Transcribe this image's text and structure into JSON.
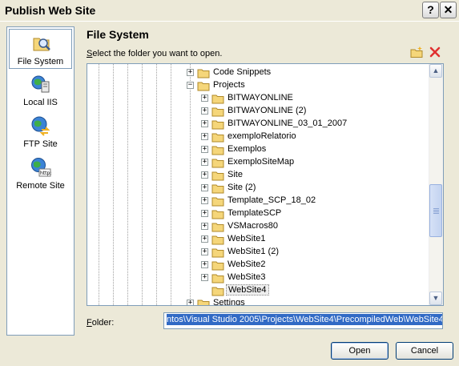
{
  "window": {
    "title": "Publish Web Site",
    "help_glyph": "?",
    "close_glyph": "✕"
  },
  "sidebar": {
    "items": [
      {
        "label": "File System",
        "icon": "folder-search-icon",
        "selected": true
      },
      {
        "label": "Local IIS",
        "icon": "globe-computer-icon",
        "selected": false
      },
      {
        "label": "FTP Site",
        "icon": "globe-arrows-icon",
        "selected": false
      },
      {
        "label": "Remote Site",
        "icon": "globe-http-icon",
        "selected": false
      }
    ]
  },
  "main": {
    "heading": "File System",
    "prompt_accel": "S",
    "prompt_rest": "elect the folder you want to open."
  },
  "tree": {
    "items": [
      {
        "label": "Code Snippets",
        "level": 0,
        "expander": "+"
      },
      {
        "label": "Projects",
        "level": 0,
        "expander": "−"
      },
      {
        "label": "BITWAYONLINE",
        "level": 1,
        "expander": "+"
      },
      {
        "label": "BITWAYONLINE (2)",
        "level": 1,
        "expander": "+"
      },
      {
        "label": "BITWAYONLINE_03_01_2007",
        "level": 1,
        "expander": "+"
      },
      {
        "label": "exemploRelatorio",
        "level": 1,
        "expander": "+"
      },
      {
        "label": "Exemplos",
        "level": 1,
        "expander": "+"
      },
      {
        "label": "ExemploSiteMap",
        "level": 1,
        "expander": "+"
      },
      {
        "label": "Site",
        "level": 1,
        "expander": "+"
      },
      {
        "label": "Site (2)",
        "level": 1,
        "expander": "+"
      },
      {
        "label": "Template_SCP_18_02",
        "level": 1,
        "expander": "+"
      },
      {
        "label": "TemplateSCP",
        "level": 1,
        "expander": "+"
      },
      {
        "label": "VSMacros80",
        "level": 1,
        "expander": "+"
      },
      {
        "label": "WebSite1",
        "level": 1,
        "expander": "+"
      },
      {
        "label": "WebSite1 (2)",
        "level": 1,
        "expander": "+"
      },
      {
        "label": "WebSite2",
        "level": 1,
        "expander": "+"
      },
      {
        "label": "WebSite3",
        "level": 1,
        "expander": "+"
      },
      {
        "label": "WebSite4",
        "level": 1,
        "expander": "",
        "selected": true
      },
      {
        "label": "Settings",
        "level": 0,
        "expander": "+"
      }
    ],
    "scroll_up_glyph": "▲",
    "scroll_down_glyph": "▼"
  },
  "folder": {
    "label_accel": "F",
    "label_rest": "older:",
    "value": "ntos\\Visual Studio 2005\\Projects\\WebSite4\\PrecompiledWeb\\WebSite4"
  },
  "buttons": {
    "open": "Open",
    "cancel": "Cancel"
  },
  "colors": {
    "border": "#7f9db9",
    "selection": "#316ac5",
    "folder": "#f5d67a"
  }
}
